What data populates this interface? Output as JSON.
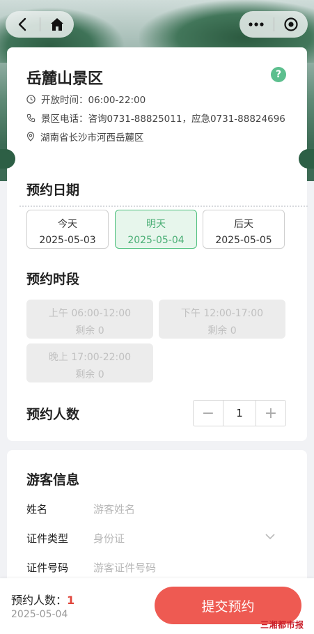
{
  "scenic": {
    "title": "岳麓山景区",
    "open_time": "开放时间：06:00-22:00",
    "phone": "景区电话：咨询0731-88825011，应急0731-88824696",
    "address": "湖南省长沙市河西岳麓区"
  },
  "date_section": {
    "title": "预约日期",
    "options": [
      {
        "label": "今天",
        "date": "2025-05-03",
        "selected": false
      },
      {
        "label": "明天",
        "date": "2025-05-04",
        "selected": true
      },
      {
        "label": "后天",
        "date": "2025-05-05",
        "selected": false
      }
    ]
  },
  "slot_section": {
    "title": "预约时段",
    "slots": [
      {
        "time": "上午 06:00-12:00",
        "remain": "剩余 0"
      },
      {
        "time": "下午 12:00-17:00",
        "remain": "剩余 0"
      },
      {
        "time": "晚上 17:00-22:00",
        "remain": "剩余 0"
      }
    ]
  },
  "people_section": {
    "title": "预约人数",
    "value": "1",
    "minus": "−",
    "plus": "+"
  },
  "visitor": {
    "title": "游客信息",
    "name_label": "姓名",
    "name_placeholder": "游客姓名",
    "id_type_label": "证件类型",
    "id_type_value": "身份证",
    "id_no_label": "证件号码",
    "id_no_placeholder": "游客证件号码"
  },
  "footer": {
    "count_label": "预约人数：",
    "count_value": "1",
    "date": "2025-05-04",
    "submit_label": "提交预约",
    "watermark": "三湘都市报"
  },
  "colors": {
    "accent_green": "#4fc07e",
    "submit_red": "#ee5a52",
    "count_red": "#e0453b"
  },
  "icons": [
    "back-icon",
    "home-icon",
    "more-icon",
    "close-target-icon",
    "help-icon",
    "clock-icon",
    "phone-icon",
    "location-icon",
    "chevron-down-icon"
  ]
}
